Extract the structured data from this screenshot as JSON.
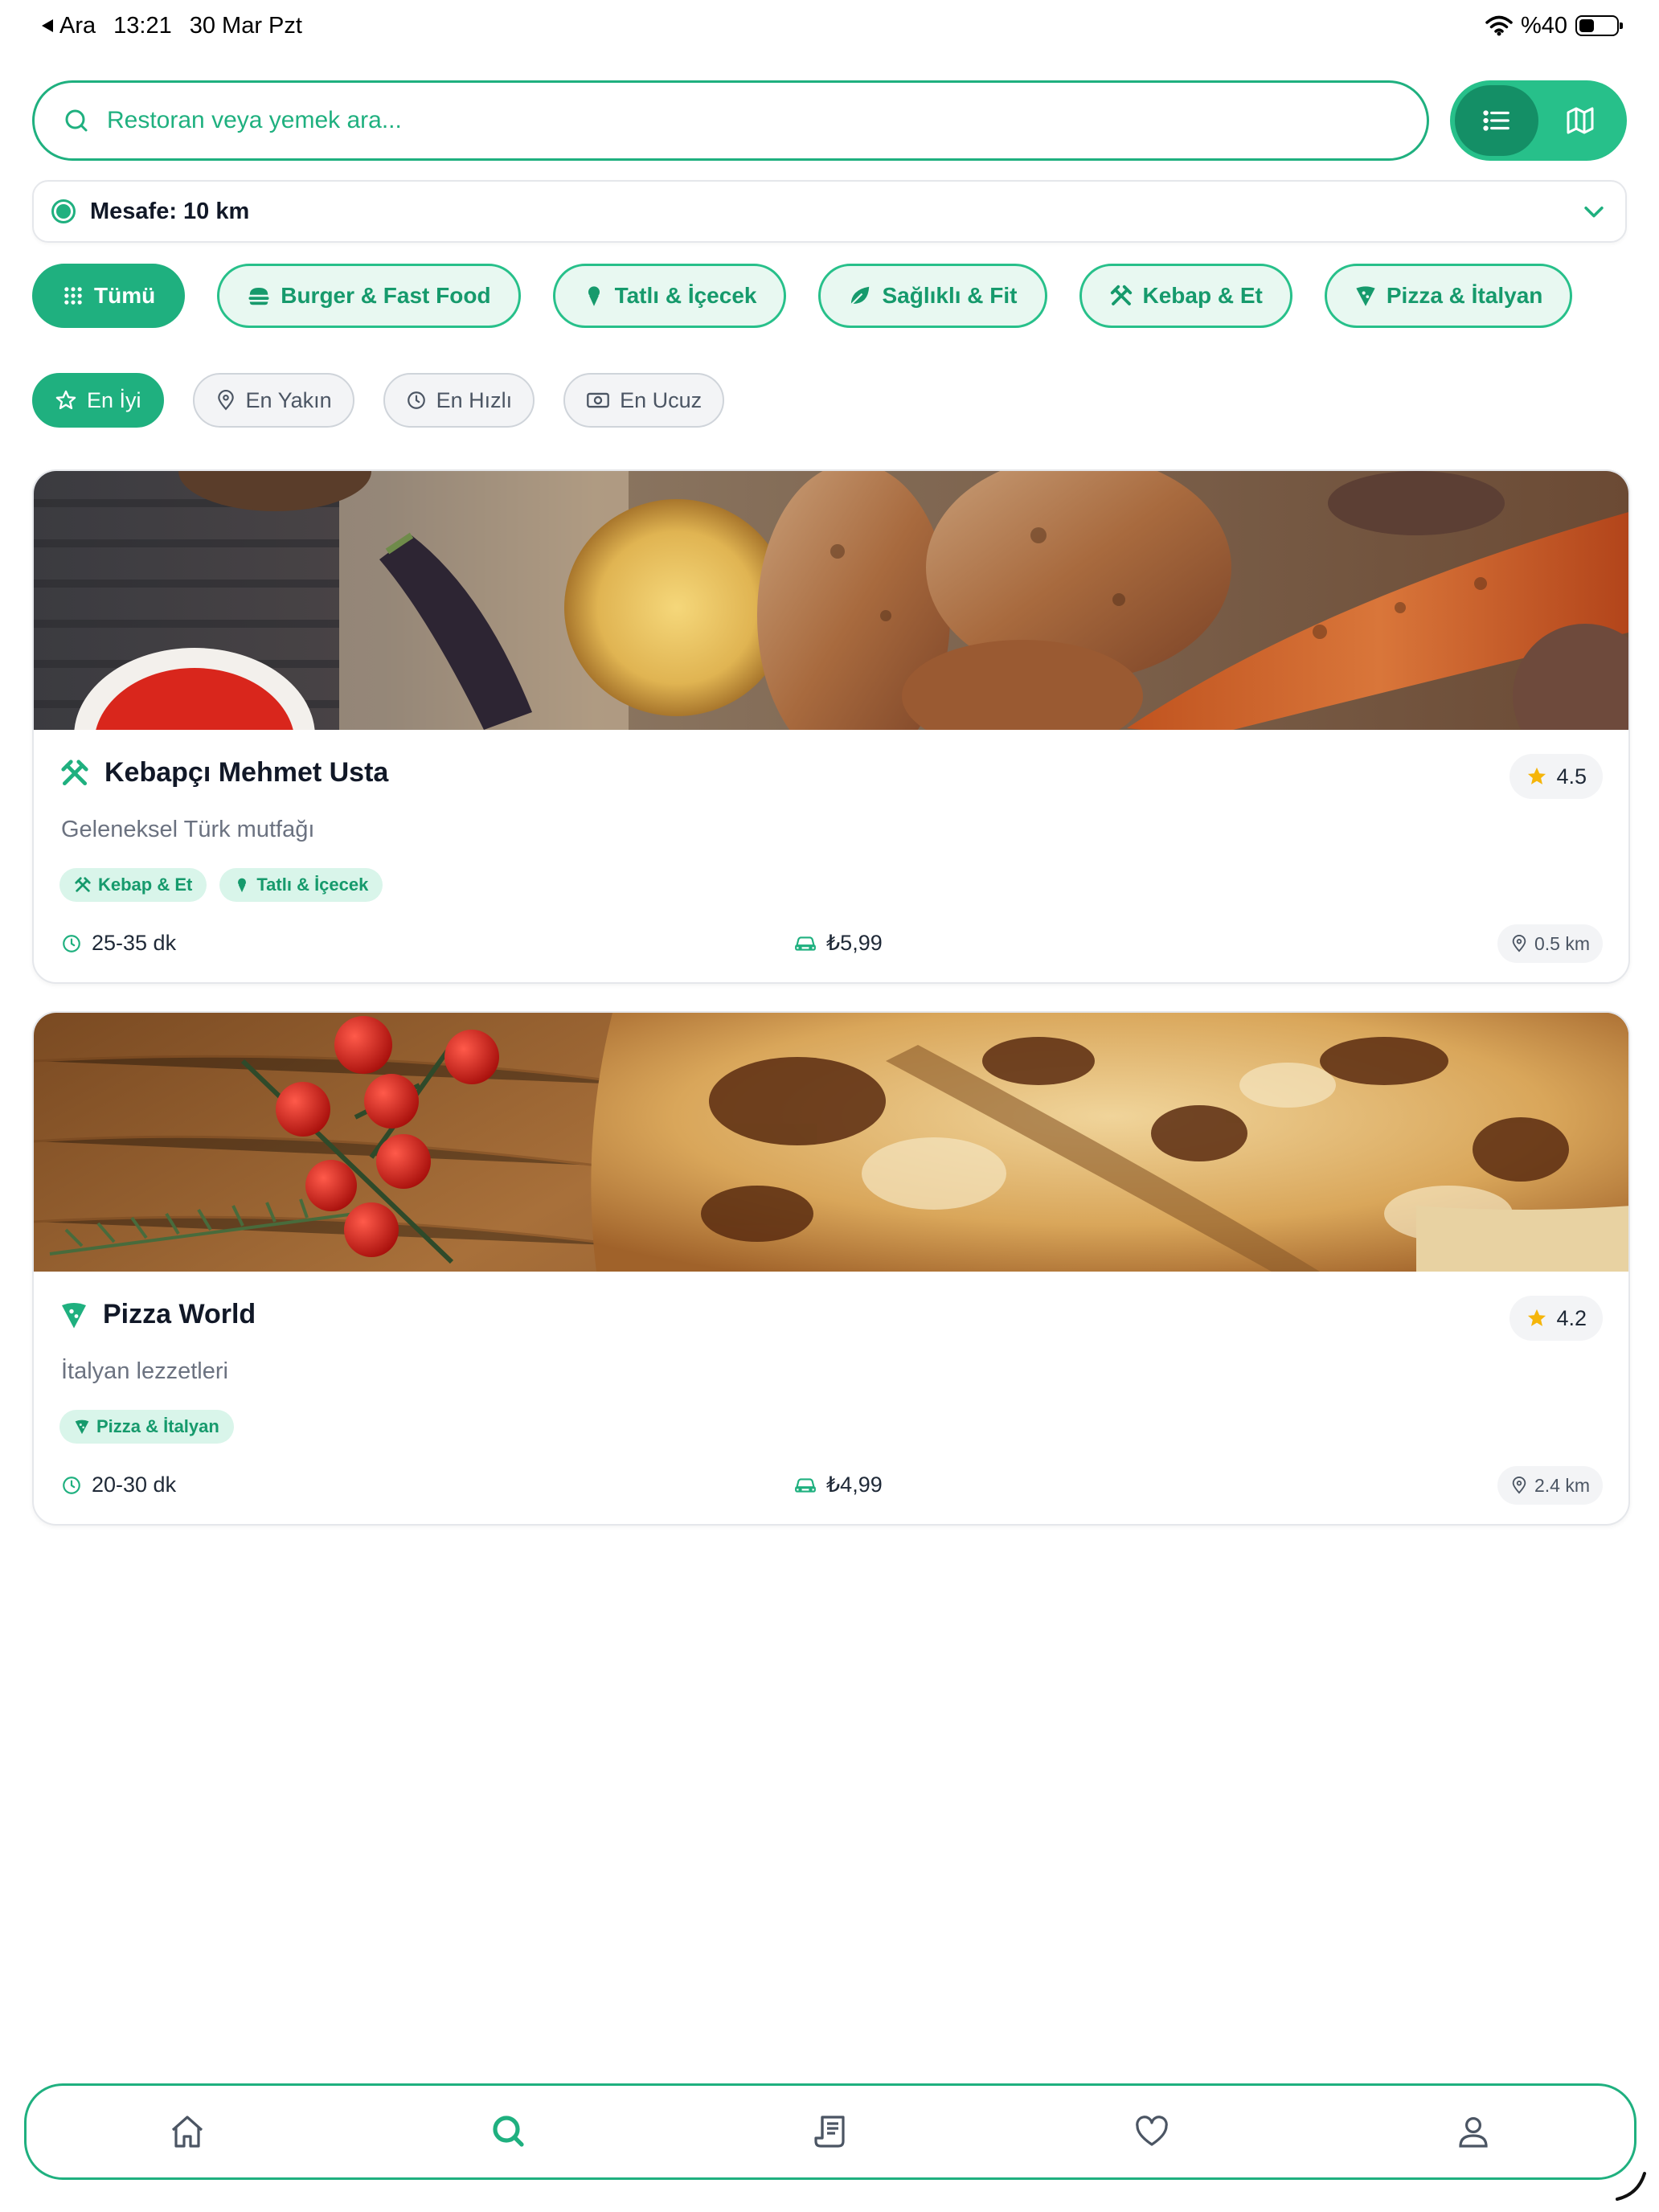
{
  "status_bar": {
    "back_label": "Ara",
    "time": "13:21",
    "date": "30 Mar Pzt",
    "battery": "%40",
    "battery_level": 0.4
  },
  "search": {
    "placeholder": "Restoran veya yemek ara..."
  },
  "view_toggle": {
    "options": [
      "list-icon",
      "map-icon"
    ],
    "active": "list"
  },
  "distance": {
    "label": "Mesafe: 10 km"
  },
  "categories": [
    {
      "label": "Tümü",
      "icon": "grid-icon",
      "active": true
    },
    {
      "label": "Burger & Fast Food",
      "icon": "burger-icon",
      "active": false
    },
    {
      "label": "Tatlı & İçecek",
      "icon": "ice-cream-icon",
      "active": false
    },
    {
      "label": "Sağlıklı & Fit",
      "icon": "leaf-icon",
      "active": false
    },
    {
      "label": "Kebap & Et",
      "icon": "utensils-icon",
      "active": false
    },
    {
      "label": "Pizza & İtalyan",
      "icon": "pizza-icon",
      "active": false
    }
  ],
  "sorts": [
    {
      "label": "En İyi",
      "icon": "star-icon",
      "active": true
    },
    {
      "label": "En Yakın",
      "icon": "pin-icon",
      "active": false
    },
    {
      "label": "En Hızlı",
      "icon": "clock-icon",
      "active": false
    },
    {
      "label": "En Ucuz",
      "icon": "cash-icon",
      "active": false
    }
  ],
  "restaurants": [
    {
      "name": "Kebapçı Mehmet Usta",
      "icon": "utensils-icon",
      "rating": "4.5",
      "description": "Geleneksel Türk mutfağı",
      "tags": [
        "Kebap & Et",
        "Tatlı & İçecek"
      ],
      "delivery_time": "25-35 dk",
      "delivery_fee": "₺5,99",
      "distance": "0.5 km",
      "image": "grilled-meat-photo"
    },
    {
      "name": "Pizza World",
      "icon": "pizza-icon",
      "rating": "4.2",
      "description": "İtalyan lezzetleri",
      "tags": [
        "Pizza & İtalyan"
      ],
      "delivery_time": "20-30 dk",
      "delivery_fee": "₺4,99",
      "distance": "2.4 km",
      "image": "pizza-photo"
    }
  ],
  "bottom_nav": [
    {
      "name": "home-icon",
      "active": false
    },
    {
      "name": "search-icon",
      "active": true
    },
    {
      "name": "receipt-icon",
      "active": false
    },
    {
      "name": "heart-icon",
      "active": false
    },
    {
      "name": "user-icon",
      "active": false
    }
  ],
  "colors": {
    "accent": "#1fb07f",
    "accent_dark": "#148f66",
    "chip_bg": "#e8f8f1",
    "star": "#f5b50a"
  }
}
